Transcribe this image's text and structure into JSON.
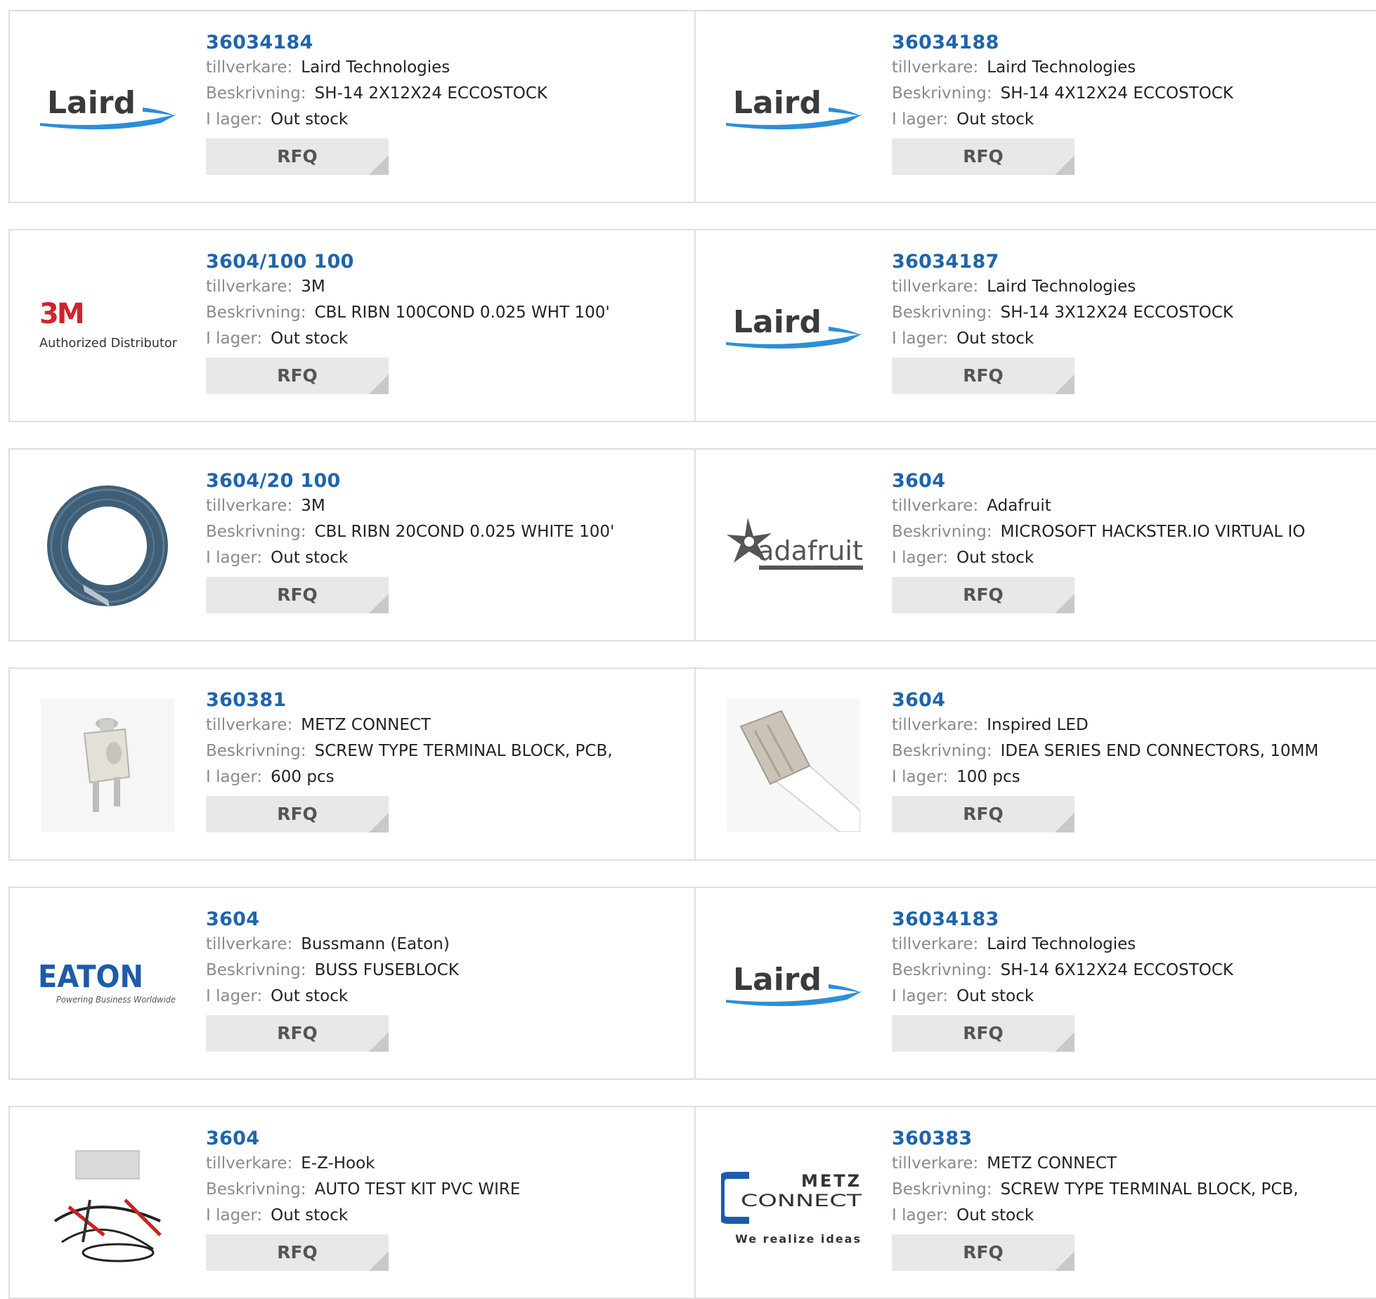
{
  "labels": {
    "manufacturer": "tillverkare:",
    "description": "Beskrivning:",
    "stock": "I lager:",
    "rfq": "RFQ"
  },
  "products": [
    {
      "part": "36034184",
      "manufacturer": "Laird Technologies",
      "description": "SH-14 2X12X24 ECCOSTOCK",
      "stock": "Out stock",
      "image": "laird-logo",
      "logo_text": "Laird"
    },
    {
      "part": "36034188",
      "manufacturer": "Laird Technologies",
      "description": "SH-14 4X12X24 ECCOSTOCK",
      "stock": "Out stock",
      "image": "laird-logo",
      "logo_text": "Laird"
    },
    {
      "part": "3604/100 100",
      "manufacturer": "3M",
      "description": "CBL RIBN 100COND 0.025 WHT 100'",
      "stock": "Out stock",
      "image": "3m-logo",
      "logo_text": "3M",
      "logo_subtext": "Authorized Distributor"
    },
    {
      "part": "36034187",
      "manufacturer": "Laird Technologies",
      "description": "SH-14 3X12X24 ECCOSTOCK",
      "stock": "Out stock",
      "image": "laird-logo",
      "logo_text": "Laird"
    },
    {
      "part": "3604/20 100",
      "manufacturer": "3M",
      "description": "CBL RIBN 20COND 0.025 WHITE 100'",
      "stock": "Out stock",
      "image": "ribbon-cable-reel"
    },
    {
      "part": "3604",
      "manufacturer": "Adafruit",
      "description": "MICROSOFT HACKSTER.IO VIRTUAL IO",
      "stock": "Out stock",
      "image": "adafruit-logo",
      "logo_text": "adafruit"
    },
    {
      "part": "360381",
      "manufacturer": "METZ CONNECT",
      "description": "SCREW TYPE TERMINAL BLOCK, PCB,",
      "stock": "600 pcs",
      "image": "terminal-block-photo"
    },
    {
      "part": "3604",
      "manufacturer": "Inspired LED",
      "description": "IDEA SERIES END CONNECTORS, 10MM",
      "stock": "100 pcs",
      "image": "led-connector-photo"
    },
    {
      "part": "3604",
      "manufacturer": "Bussmann (Eaton)",
      "description": "BUSS FUSEBLOCK",
      "stock": "Out stock",
      "image": "eaton-logo",
      "logo_text": "EATON",
      "logo_subtext": "Powering Business Worldwide"
    },
    {
      "part": "36034183",
      "manufacturer": "Laird Technologies",
      "description": "SH-14 6X12X24 ECCOSTOCK",
      "stock": "Out stock",
      "image": "laird-logo",
      "logo_text": "Laird"
    },
    {
      "part": "3604",
      "manufacturer": "E-Z-Hook",
      "description": "AUTO TEST KIT PVC WIRE",
      "stock": "Out stock",
      "image": "test-kit-photo"
    },
    {
      "part": "360383",
      "manufacturer": "METZ CONNECT",
      "description": "SCREW TYPE TERMINAL BLOCK, PCB,",
      "stock": "Out stock",
      "image": "metz-connect-logo",
      "logo_text": "METZ",
      "logo_text2": "CONNECT",
      "logo_subtext": "We realize ideas"
    }
  ],
  "colors": {
    "link": "#1e64ad",
    "label": "#8a8a8a",
    "border": "#dedede",
    "button": "#e8e8e8"
  }
}
